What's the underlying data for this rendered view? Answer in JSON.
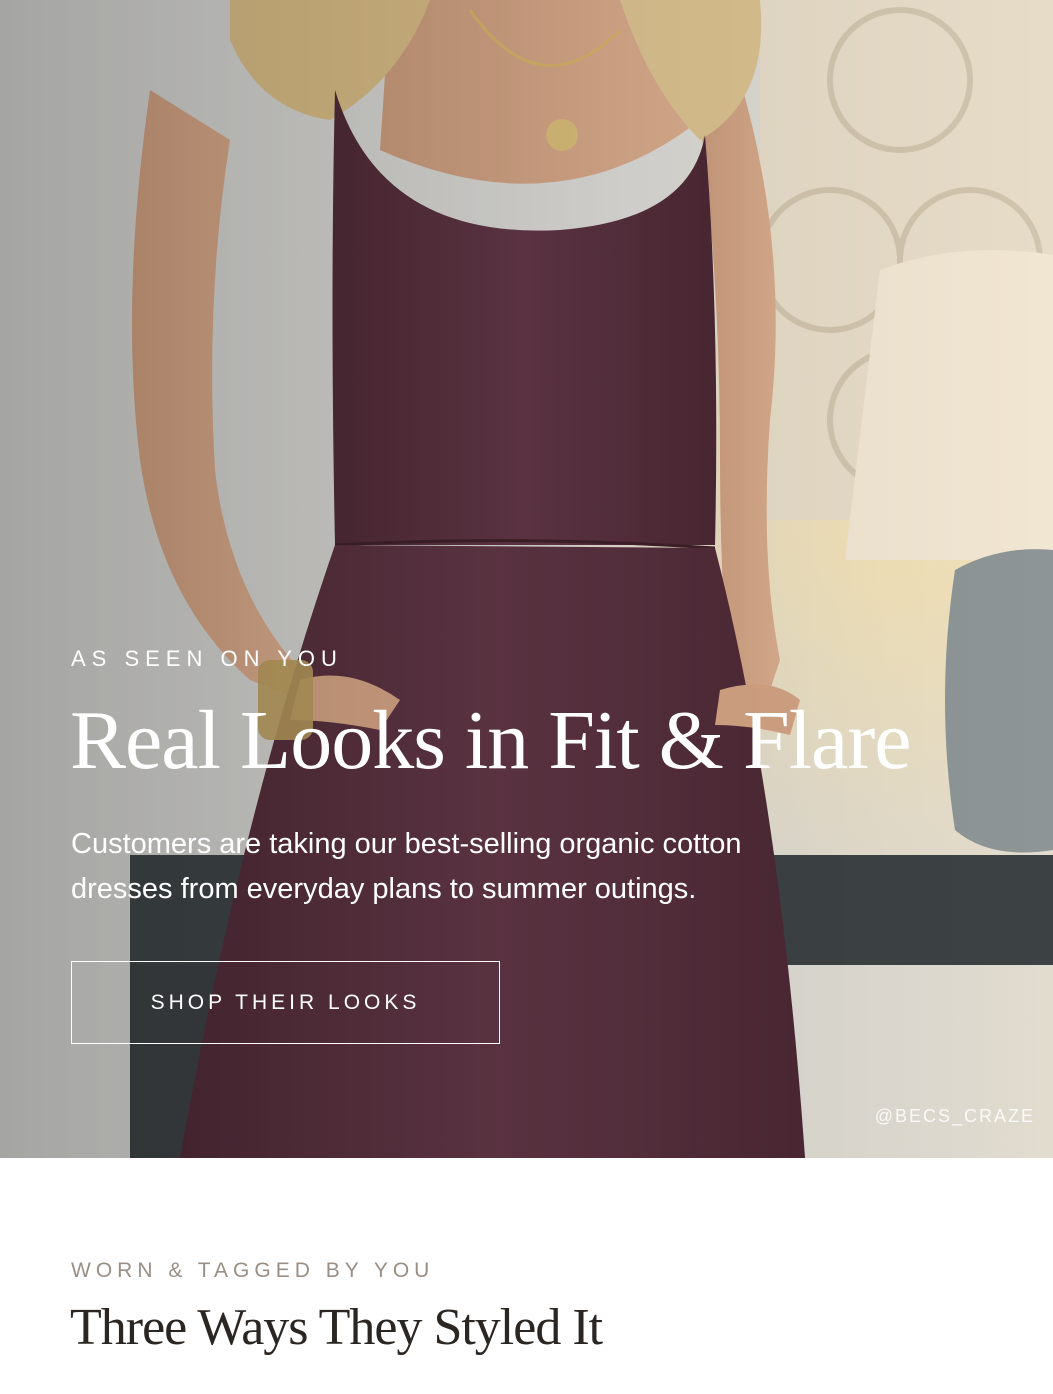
{
  "hero": {
    "eyebrow": "AS SEEN ON YOU",
    "title": "Real Looks in Fit & Flare",
    "description": "Customers are taking our best-selling organic cotton dresses from everyday plans to summer outings.",
    "cta_label": "SHOP THEIR LOOKS",
    "photo_credit": "@BECS_CRAZE",
    "photo_subject": "woman wearing plum sleeveless fit-and-flare dress"
  },
  "section": {
    "eyebrow": "WORN & TAGGED BY YOU",
    "title": "Three Ways They Styled It"
  },
  "colors": {
    "dress": "#5b3140",
    "wall": "#d6d6d3",
    "eyebrow_muted": "#9a8f84",
    "heading_dark": "#2b2622"
  }
}
